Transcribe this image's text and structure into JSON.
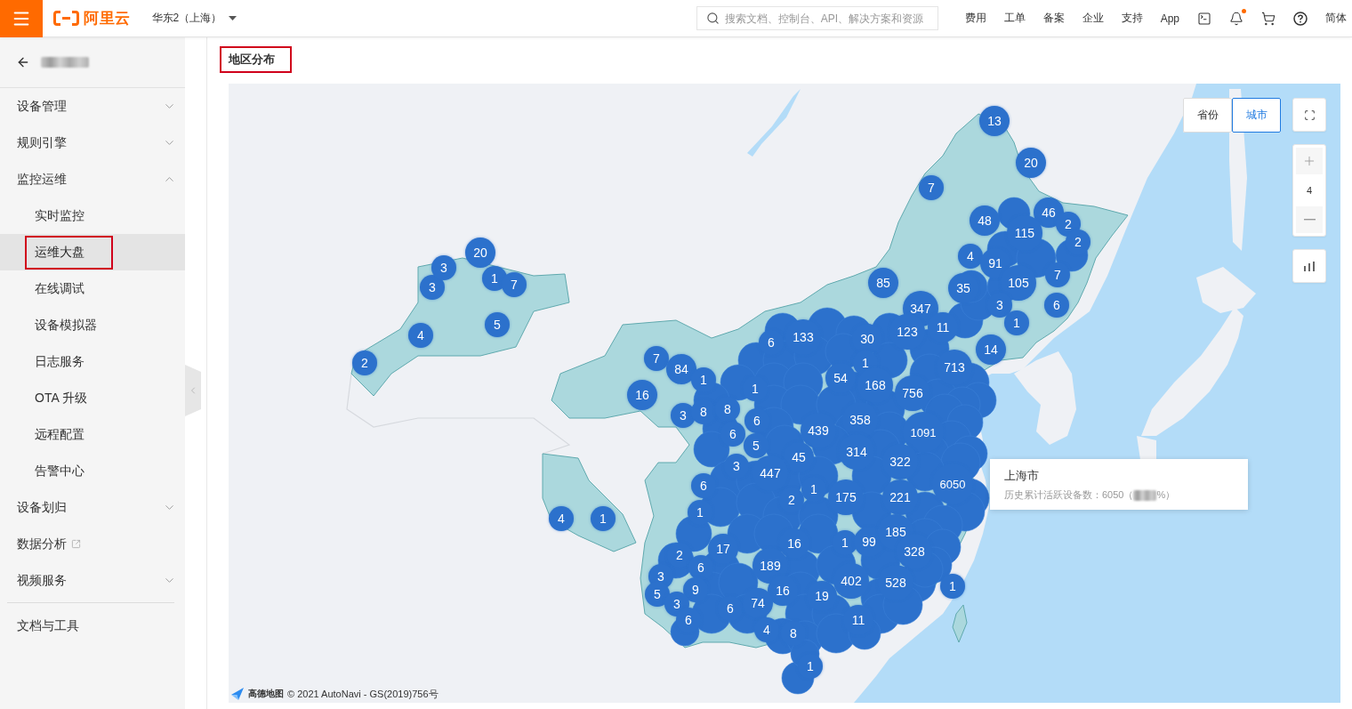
{
  "topbar": {
    "logo": "阿里云",
    "region": "华东2（上海）",
    "search": {
      "placeholder": "搜索文档、控制台、API、解决方案和资源"
    },
    "links": [
      "费用",
      "工单",
      "备案",
      "企业",
      "支持",
      "App"
    ],
    "notifications": {
      "unread": true
    },
    "language": "简体"
  },
  "sidebar": {
    "title_blurred": true,
    "items": [
      {
        "kind": "group",
        "label": "设备管理",
        "expanded": false
      },
      {
        "kind": "group",
        "label": "规则引擎",
        "expanded": false
      },
      {
        "kind": "group",
        "label": "监控运维",
        "expanded": true,
        "children": [
          {
            "label": "实时监控",
            "selected": false,
            "highlighted": false
          },
          {
            "label": "运维大盘",
            "selected": true,
            "highlighted": true
          },
          {
            "label": "在线调试",
            "selected": false,
            "highlighted": false
          },
          {
            "label": "设备模拟器",
            "selected": false,
            "highlighted": false
          },
          {
            "label": "日志服务",
            "selected": false,
            "highlighted": false
          },
          {
            "label": "OTA 升级",
            "selected": false,
            "highlighted": false
          },
          {
            "label": "远程配置",
            "selected": false,
            "highlighted": false
          },
          {
            "label": "告警中心",
            "selected": false,
            "highlighted": false
          }
        ]
      },
      {
        "kind": "group",
        "label": "设备划归",
        "expanded": false
      },
      {
        "kind": "external",
        "label": "数据分析"
      },
      {
        "kind": "group",
        "label": "视频服务",
        "expanded": false
      }
    ],
    "footer_items": [
      "文档与工具"
    ]
  },
  "section": {
    "title": "地区分布",
    "highlighted": true
  },
  "map": {
    "view_toggle": [
      {
        "label": "省份",
        "selected": false
      },
      {
        "label": "城市",
        "selected": true
      }
    ],
    "zoom": "4",
    "clusters": [
      {
        "count": "13"
      },
      {
        "count": "20"
      },
      {
        "count": "7"
      },
      {
        "count": "48"
      },
      {
        "count": "46"
      },
      {
        "count": "115"
      },
      {
        "count": "2"
      },
      {
        "count": "2"
      },
      {
        "count": "3"
      },
      {
        "count": "3"
      },
      {
        "count": "20"
      },
      {
        "count": "1"
      },
      {
        "count": "7"
      },
      {
        "count": "85"
      },
      {
        "count": "35"
      },
      {
        "count": "4"
      },
      {
        "count": "91"
      },
      {
        "count": "105"
      },
      {
        "count": "7"
      },
      {
        "count": "347"
      },
      {
        "count": "3"
      },
      {
        "count": "6"
      },
      {
        "count": "4"
      },
      {
        "count": "5"
      },
      {
        "count": "6"
      },
      {
        "count": "133"
      },
      {
        "count": "30"
      },
      {
        "count": "123"
      },
      {
        "count": "11"
      },
      {
        "count": "1"
      },
      {
        "count": "2"
      },
      {
        "count": "7"
      },
      {
        "count": "84"
      },
      {
        "count": "1"
      },
      {
        "count": "713"
      },
      {
        "count": "14"
      },
      {
        "count": "16"
      },
      {
        "count": "1"
      },
      {
        "count": "1"
      },
      {
        "count": "54"
      },
      {
        "count": "168"
      },
      {
        "count": "756"
      },
      {
        "count": "3"
      },
      {
        "count": "8"
      },
      {
        "count": "8"
      },
      {
        "count": "6"
      },
      {
        "count": "6"
      },
      {
        "count": "439"
      },
      {
        "count": "358"
      },
      {
        "count": "1091"
      },
      {
        "count": "5"
      },
      {
        "count": "45"
      },
      {
        "count": "314"
      },
      {
        "count": "3"
      },
      {
        "count": "447"
      },
      {
        "count": "322"
      },
      {
        "count": "6"
      },
      {
        "count": "2"
      },
      {
        "count": "1"
      },
      {
        "count": "175"
      },
      {
        "count": "221"
      },
      {
        "count": "6050"
      },
      {
        "count": "4"
      },
      {
        "count": "1"
      },
      {
        "count": "1"
      },
      {
        "count": "17"
      },
      {
        "count": "16"
      },
      {
        "count": "1"
      },
      {
        "count": "99"
      },
      {
        "count": "185"
      },
      {
        "count": "2"
      },
      {
        "count": "6"
      },
      {
        "count": "189"
      },
      {
        "count": "328"
      },
      {
        "count": "3"
      },
      {
        "count": "5"
      },
      {
        "count": "9"
      },
      {
        "count": "16"
      },
      {
        "count": "19"
      },
      {
        "count": "402"
      },
      {
        "count": "528"
      },
      {
        "count": "1"
      },
      {
        "count": "3"
      },
      {
        "count": "6"
      },
      {
        "count": "74"
      },
      {
        "count": "6"
      },
      {
        "count": "4"
      },
      {
        "count": "8"
      },
      {
        "count": "11"
      },
      {
        "count": "1"
      }
    ],
    "tooltip": {
      "title": "上海市",
      "detail": "历史累计活跃设备数：6050（",
      "value_blurred": true,
      "detail_end": "%）"
    },
    "attribution": {
      "logo": "高德地图",
      "text": "© 2021 AutoNavi - GS(2019)756号"
    }
  }
}
